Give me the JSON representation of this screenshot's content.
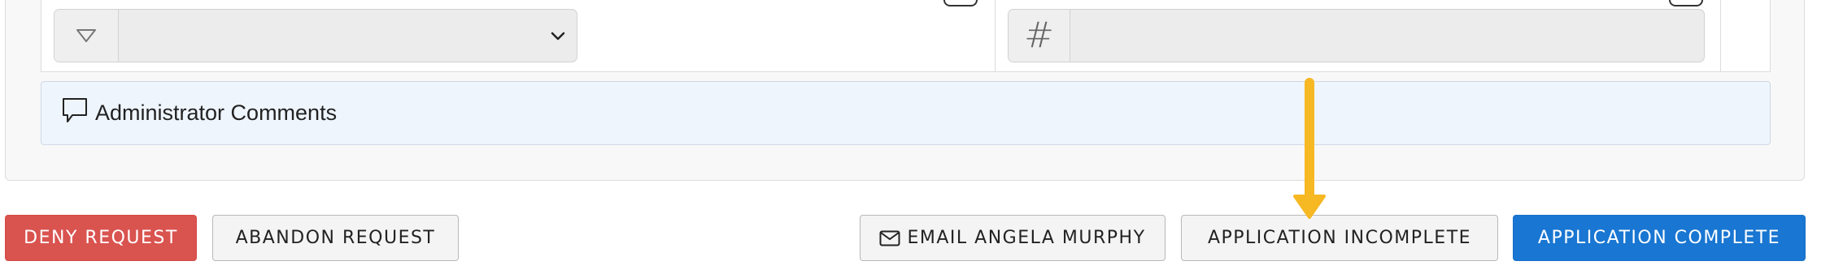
{
  "form": {
    "select_field": {
      "value": ""
    },
    "number_field": {
      "value": "",
      "addon_symbol": "#"
    }
  },
  "comments": {
    "title": "Administrator Comments"
  },
  "actions": {
    "deny_label": "DENY REQUEST",
    "abandon_label": "ABANDON REQUEST",
    "email_label": "EMAIL ANGELA MURPHY",
    "incomplete_label": "APPLICATION INCOMPLETE",
    "complete_label": "APPLICATION COMPLETE"
  },
  "colors": {
    "danger": "#d9534f",
    "primary": "#1976d2",
    "comments_bg": "#eef5fd",
    "annotation_arrow": "#f6b823"
  },
  "icons": [
    "filter-icon",
    "chevron-down-icon",
    "comment-icon",
    "envelope-icon",
    "edit-icon",
    "annotation-arrow"
  ]
}
